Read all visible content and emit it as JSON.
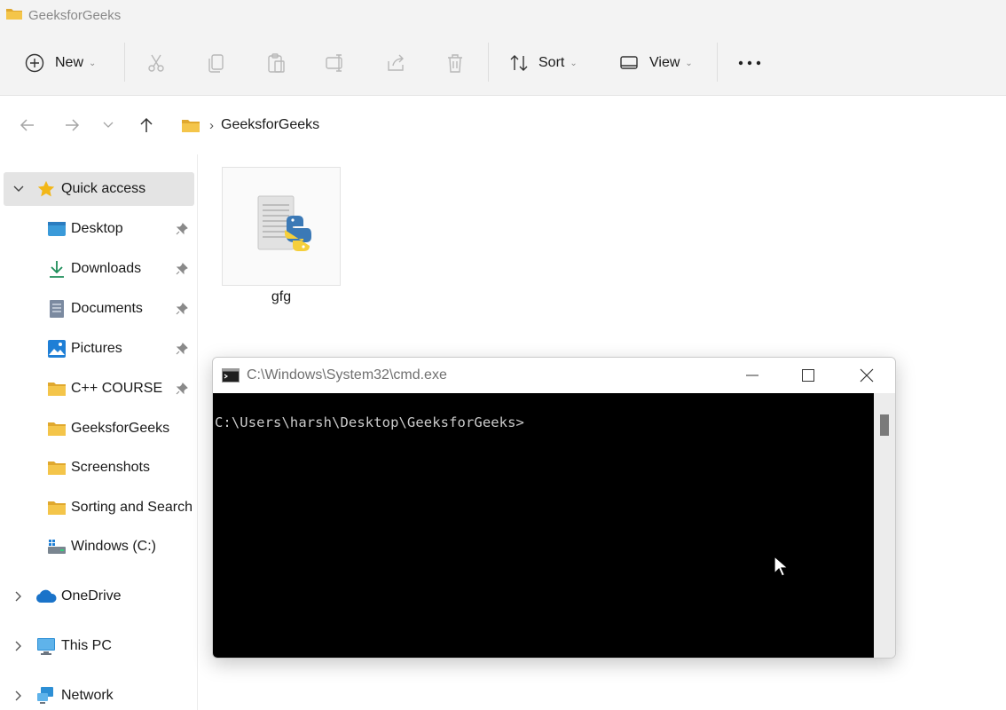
{
  "window": {
    "title": "GeeksforGeeks"
  },
  "toolbar": {
    "new_label": "New",
    "sort_label": "Sort",
    "view_label": "View",
    "more_label": "..."
  },
  "address": {
    "crumbs": [
      "GeeksforGeeks"
    ]
  },
  "sidebar": {
    "quick_access": "Quick access",
    "items": [
      {
        "label": "Desktop",
        "icon": "desktop-icon",
        "pinned": true
      },
      {
        "label": "Downloads",
        "icon": "download-icon",
        "pinned": true
      },
      {
        "label": "Documents",
        "icon": "documents-icon",
        "pinned": true
      },
      {
        "label": "Pictures",
        "icon": "pictures-icon",
        "pinned": true
      },
      {
        "label": "C++ COURSE",
        "icon": "folder-icon",
        "pinned": true
      },
      {
        "label": "GeeksforGeeks",
        "icon": "folder-icon",
        "pinned": false
      },
      {
        "label": "Screenshots",
        "icon": "folder-icon",
        "pinned": false
      },
      {
        "label": "Sorting and Search",
        "icon": "folder-icon",
        "pinned": false
      },
      {
        "label": "Windows (C:)",
        "icon": "drive-icon",
        "pinned": false
      }
    ],
    "onedrive": "OneDrive",
    "this_pc": "This PC",
    "network": "Network"
  },
  "files": [
    {
      "name": "gfg",
      "icon": "python-file-icon"
    }
  ],
  "cmd": {
    "title": "C:\\Windows\\System32\\cmd.exe",
    "prompt": "C:\\Users\\harsh\\Desktop\\GeeksforGeeks>"
  },
  "colors": {
    "folder": "#f4c54a",
    "folder_dark": "#e0a82e",
    "accent_blue": "#1a73c9",
    "star": "#f2b718",
    "console_bg": "#000000",
    "console_text": "#cccccc"
  }
}
